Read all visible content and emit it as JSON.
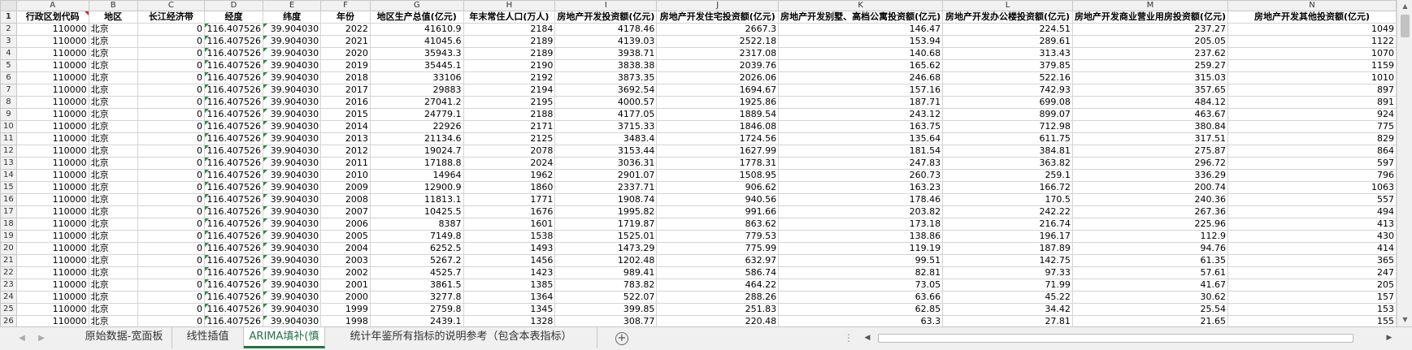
{
  "columns": [
    "A",
    "B",
    "C",
    "D",
    "E",
    "F",
    "G",
    "H",
    "I",
    "J",
    "K",
    "L",
    "M",
    "N"
  ],
  "headers": [
    "行政区划代码",
    "地区",
    "长江经济带",
    "经度",
    "纬度",
    "年份",
    "地区生产总值(亿元)",
    "年末常住人口(万人)",
    "房地产开发投资额(亿元)",
    "房地产开发住宅投资额(亿元)",
    "房地产开发别墅、高档公寓投资额(亿元)",
    "房地产开发办公楼投资额(亿元)",
    "房地产开发商业营业用房投资额(亿元)",
    "房地产开发其他投资额(亿元)"
  ],
  "rows": [
    [
      "110000",
      "北京",
      "0",
      "116.407526",
      "39.904030",
      "2022",
      "41610.9",
      "2184",
      "4178.46",
      "2667.3",
      "146.47",
      "224.51",
      "237.27",
      "1049"
    ],
    [
      "110000",
      "北京",
      "0",
      "116.407526",
      "39.904030",
      "2021",
      "41045.6",
      "2189",
      "4139.03",
      "2522.18",
      "153.94",
      "289.61",
      "205.05",
      "1122"
    ],
    [
      "110000",
      "北京",
      "0",
      "116.407526",
      "39.904030",
      "2020",
      "35943.3",
      "2189",
      "3938.71",
      "2317.08",
      "140.68",
      "313.43",
      "237.62",
      "1070"
    ],
    [
      "110000",
      "北京",
      "0",
      "116.407526",
      "39.904030",
      "2019",
      "35445.1",
      "2190",
      "3838.38",
      "2039.76",
      "165.62",
      "379.85",
      "259.27",
      "1159"
    ],
    [
      "110000",
      "北京",
      "0",
      "116.407526",
      "39.904030",
      "2018",
      "33106",
      "2192",
      "3873.35",
      "2026.06",
      "246.68",
      "522.16",
      "315.03",
      "1010"
    ],
    [
      "110000",
      "北京",
      "0",
      "116.407526",
      "39.904030",
      "2017",
      "29883",
      "2194",
      "3692.54",
      "1694.67",
      "157.16",
      "742.93",
      "357.65",
      "897"
    ],
    [
      "110000",
      "北京",
      "0",
      "116.407526",
      "39.904030",
      "2016",
      "27041.2",
      "2195",
      "4000.57",
      "1925.86",
      "187.71",
      "699.08",
      "484.12",
      "891"
    ],
    [
      "110000",
      "北京",
      "0",
      "116.407526",
      "39.904030",
      "2015",
      "24779.1",
      "2188",
      "4177.05",
      "1889.54",
      "243.12",
      "899.07",
      "463.67",
      "924"
    ],
    [
      "110000",
      "北京",
      "0",
      "116.407526",
      "39.904030",
      "2014",
      "22926",
      "2171",
      "3715.33",
      "1846.08",
      "163.75",
      "712.98",
      "380.84",
      "775"
    ],
    [
      "110000",
      "北京",
      "0",
      "116.407526",
      "39.904030",
      "2013",
      "21134.6",
      "2125",
      "3483.4",
      "1724.56",
      "135.64",
      "611.75",
      "317.51",
      "829"
    ],
    [
      "110000",
      "北京",
      "0",
      "116.407526",
      "39.904030",
      "2012",
      "19024.7",
      "2078",
      "3153.44",
      "1627.99",
      "181.54",
      "384.81",
      "275.87",
      "864"
    ],
    [
      "110000",
      "北京",
      "0",
      "116.407526",
      "39.904030",
      "2011",
      "17188.8",
      "2024",
      "3036.31",
      "1778.31",
      "247.83",
      "363.82",
      "296.72",
      "597"
    ],
    [
      "110000",
      "北京",
      "0",
      "116.407526",
      "39.904030",
      "2010",
      "14964",
      "1962",
      "2901.07",
      "1508.95",
      "260.73",
      "259.1",
      "336.29",
      "796"
    ],
    [
      "110000",
      "北京",
      "0",
      "116.407526",
      "39.904030",
      "2009",
      "12900.9",
      "1860",
      "2337.71",
      "906.62",
      "163.23",
      "166.72",
      "200.74",
      "1063"
    ],
    [
      "110000",
      "北京",
      "0",
      "116.407526",
      "39.904030",
      "2008",
      "11813.1",
      "1771",
      "1908.74",
      "940.56",
      "178.46",
      "170.5",
      "240.36",
      "557"
    ],
    [
      "110000",
      "北京",
      "0",
      "116.407526",
      "39.904030",
      "2007",
      "10425.5",
      "1676",
      "1995.82",
      "991.66",
      "203.82",
      "242.22",
      "267.36",
      "494"
    ],
    [
      "110000",
      "北京",
      "0",
      "116.407526",
      "39.904030",
      "2006",
      "8387",
      "1601",
      "1719.87",
      "863.62",
      "173.18",
      "216.74",
      "225.96",
      "413"
    ],
    [
      "110000",
      "北京",
      "0",
      "116.407526",
      "39.904030",
      "2005",
      "7149.8",
      "1538",
      "1525.01",
      "779.53",
      "138.86",
      "196.17",
      "112.9",
      "430"
    ],
    [
      "110000",
      "北京",
      "0",
      "116.407526",
      "39.904030",
      "2004",
      "6252.5",
      "1493",
      "1473.29",
      "775.99",
      "119.19",
      "187.89",
      "94.76",
      "414"
    ],
    [
      "110000",
      "北京",
      "0",
      "116.407526",
      "39.904030",
      "2003",
      "5267.2",
      "1456",
      "1202.48",
      "632.97",
      "99.51",
      "142.75",
      "61.35",
      "365"
    ],
    [
      "110000",
      "北京",
      "0",
      "116.407526",
      "39.904030",
      "2002",
      "4525.7",
      "1423",
      "989.41",
      "586.74",
      "82.81",
      "97.33",
      "57.61",
      "247"
    ],
    [
      "110000",
      "北京",
      "0",
      "116.407526",
      "39.904030",
      "2001",
      "3861.5",
      "1385",
      "783.82",
      "464.22",
      "73.05",
      "71.99",
      "41.67",
      "205"
    ],
    [
      "110000",
      "北京",
      "0",
      "116.407526",
      "39.904030",
      "2000",
      "3277.8",
      "1364",
      "522.07",
      "288.26",
      "63.66",
      "45.22",
      "30.62",
      "157"
    ],
    [
      "110000",
      "北京",
      "0",
      "116.407526",
      "39.904030",
      "1999",
      "2759.8",
      "1345",
      "399.85",
      "251.83",
      "62.85",
      "34.42",
      "25.54",
      "153"
    ],
    [
      "110000",
      "北京",
      "0",
      "116.407526",
      "39.904030",
      "1998",
      "2439.1",
      "1328",
      "308.77",
      "220.48",
      "63.3",
      "27.81",
      "21.65",
      "155"
    ]
  ],
  "sheet_tabs": [
    "原始数据-宽面板",
    "线性插值",
    "ARIMA填补(慎用)",
    "统计年鉴所有指标的说明参考（包含本表指标）"
  ],
  "active_tab_index": 2,
  "add_sheet_label": "+",
  "colors": {
    "accent": "#217346",
    "comment_marker": "#e0201b",
    "error_marker": "#2e8b3a"
  }
}
